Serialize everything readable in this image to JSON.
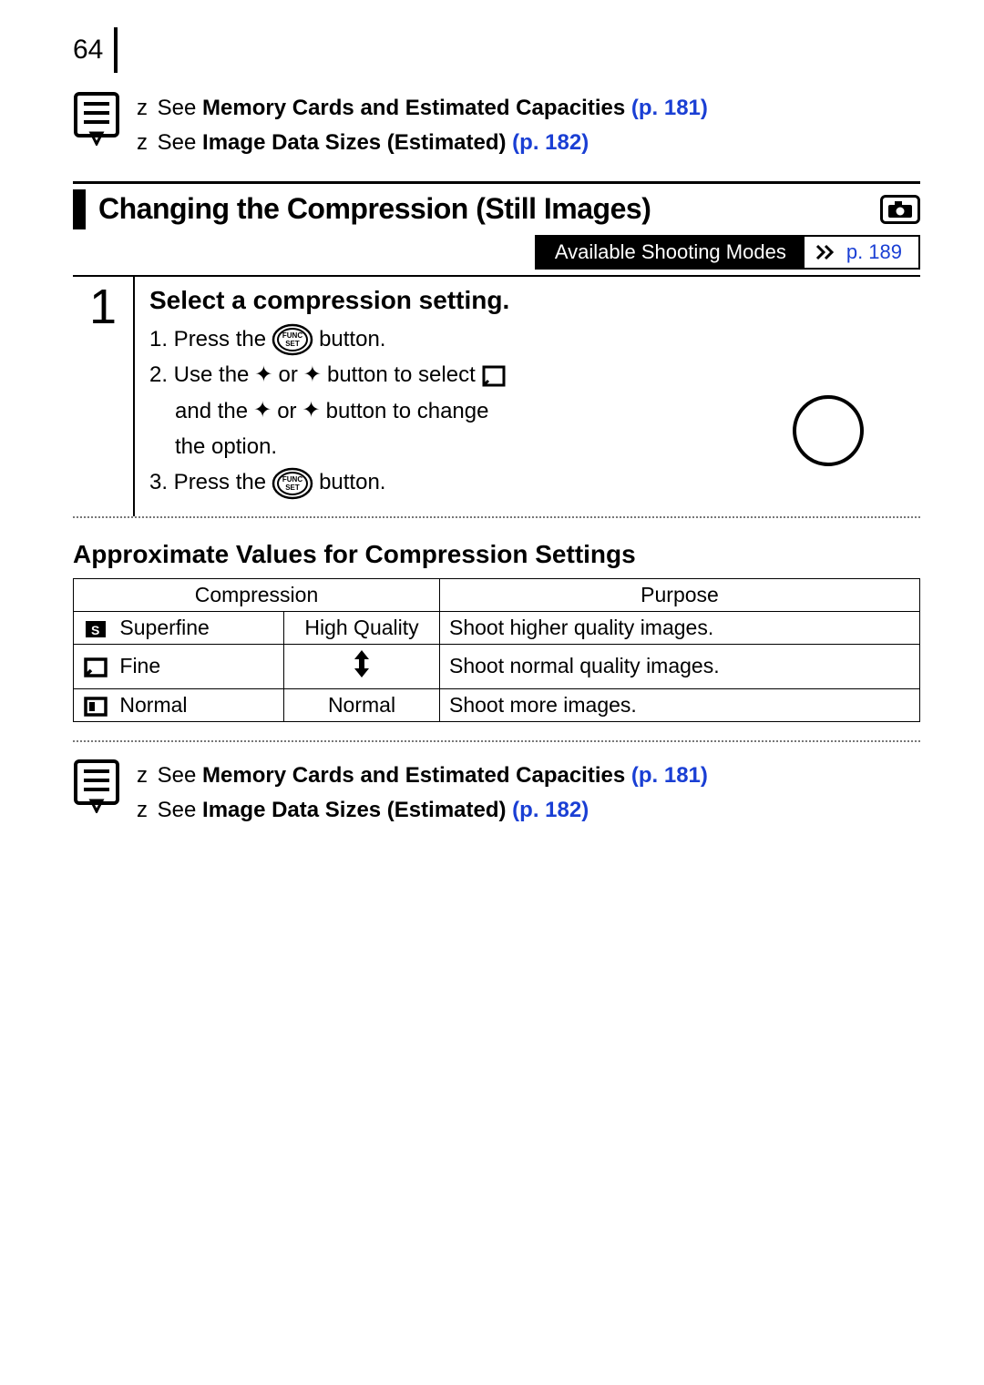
{
  "page_number": "64",
  "notes_top": {
    "items": [
      {
        "prefix": "z",
        "see": "See ",
        "bold": "Memory Cards and Estimated Capacities",
        "link": "(p. 181)"
      },
      {
        "prefix": "z",
        "see": "See ",
        "bold": "Image Data Sizes (Estimated)",
        "link": "(p. 182)"
      }
    ]
  },
  "section": {
    "title": "Changing the Compression (Still Images)",
    "modes_label": "Available Shooting Modes",
    "modes_page": "p. 189"
  },
  "step": {
    "number": "1",
    "title": "Select a compression setting.",
    "line1_a": "1. Press the",
    "line1_b": "button.",
    "line2_a": "2. Use the",
    "line2_b": "or",
    "line2_c": "button to select",
    "line3_a": "and the",
    "line3_b": "or",
    "line3_c": "button to change",
    "line4": "the option.",
    "line5_a": "3. Press the",
    "line5_b": "button."
  },
  "subheading": "Approximate Values for Compression Settings",
  "table": {
    "head_compression": "Compression",
    "head_purpose": "Purpose",
    "rows": [
      {
        "name": "Superfine",
        "quality": "High Quality",
        "purpose": "Shoot higher quality images."
      },
      {
        "name": "Fine",
        "quality": "",
        "purpose": "Shoot normal quality images."
      },
      {
        "name": "Normal",
        "quality": "Normal",
        "purpose": "Shoot more images."
      }
    ]
  },
  "notes_bottom": {
    "items": [
      {
        "prefix": "z",
        "see": "See ",
        "bold": "Memory Cards and Estimated Capacities",
        "link": "(p. 181)"
      },
      {
        "prefix": "z",
        "see": "See ",
        "bold": "Image Data Sizes (Estimated)",
        "link": "(p. 182)"
      }
    ]
  }
}
